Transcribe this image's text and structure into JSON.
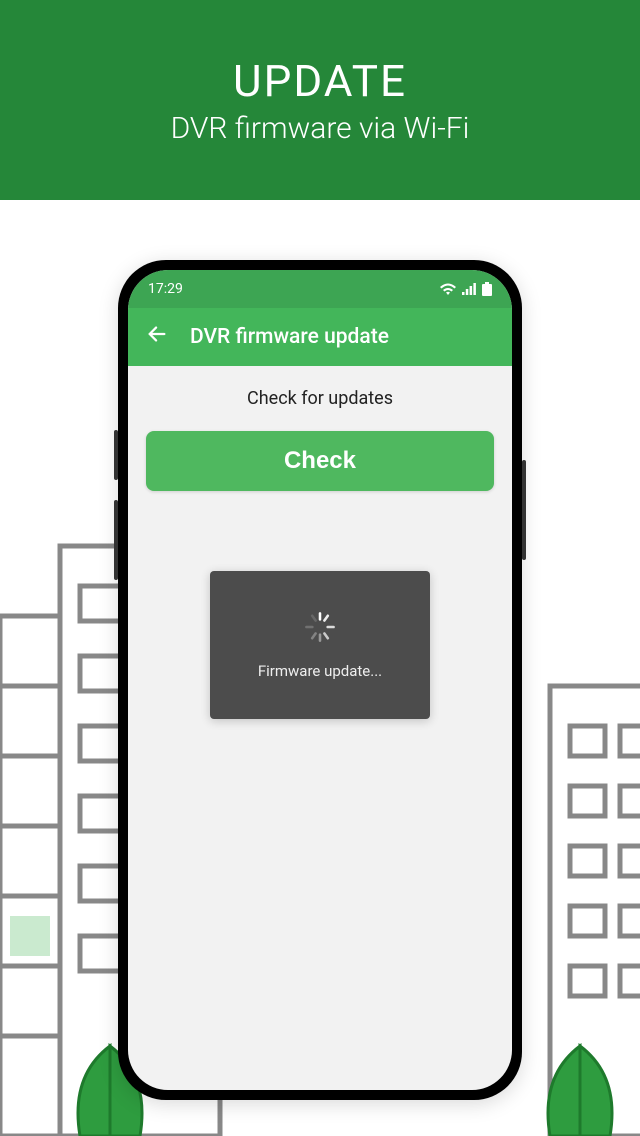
{
  "banner": {
    "title": "UPDATE",
    "subtitle": "DVR firmware via Wi-Fi"
  },
  "phone": {
    "status_bar": {
      "time": "17:29"
    },
    "app_bar": {
      "title": "DVR firmware update"
    },
    "content": {
      "heading": "Check for updates",
      "check_button_label": "Check",
      "modal_text": "Firmware update..."
    }
  }
}
